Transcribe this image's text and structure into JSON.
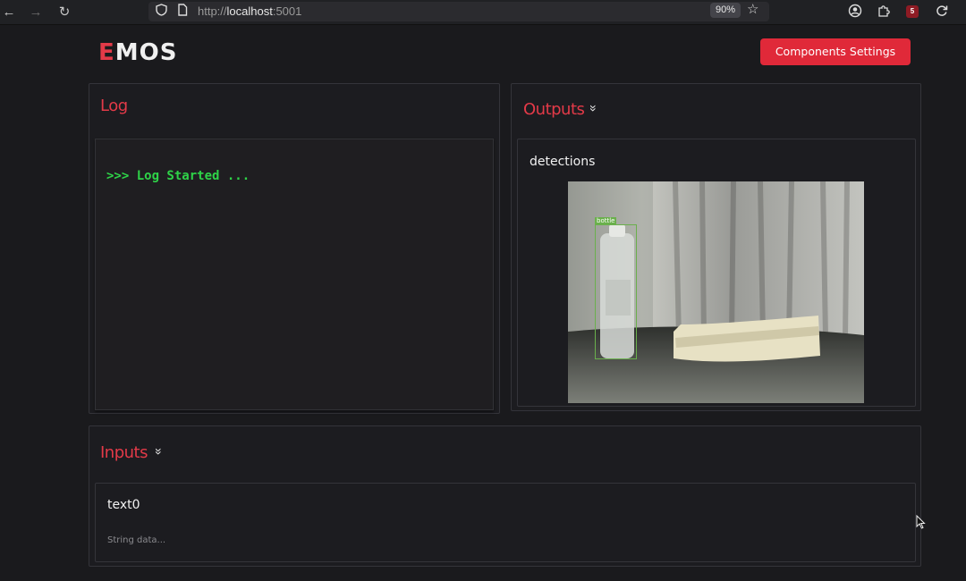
{
  "browser": {
    "url_scheme": "http://",
    "url_host": "localhost",
    "url_port": ":5001",
    "zoom": "90%",
    "extension_badge": "5"
  },
  "header": {
    "logo_accent": "E",
    "logo_rest": "MOS",
    "settings_button": "Components Settings"
  },
  "log": {
    "title": "Log",
    "lines": [
      ">>> Log Started ..."
    ]
  },
  "outputs": {
    "title": "Outputs",
    "stream": {
      "name": "detections",
      "detection_label": "bottle"
    }
  },
  "inputs": {
    "title": "Inputs",
    "field": {
      "name": "text0",
      "placeholder": "String data..."
    }
  },
  "colors": {
    "accent": "#e33a48",
    "button": "#e02939",
    "log_text": "#2ed348",
    "bbox": "#6ab04c",
    "background": "#1a1a1d"
  }
}
